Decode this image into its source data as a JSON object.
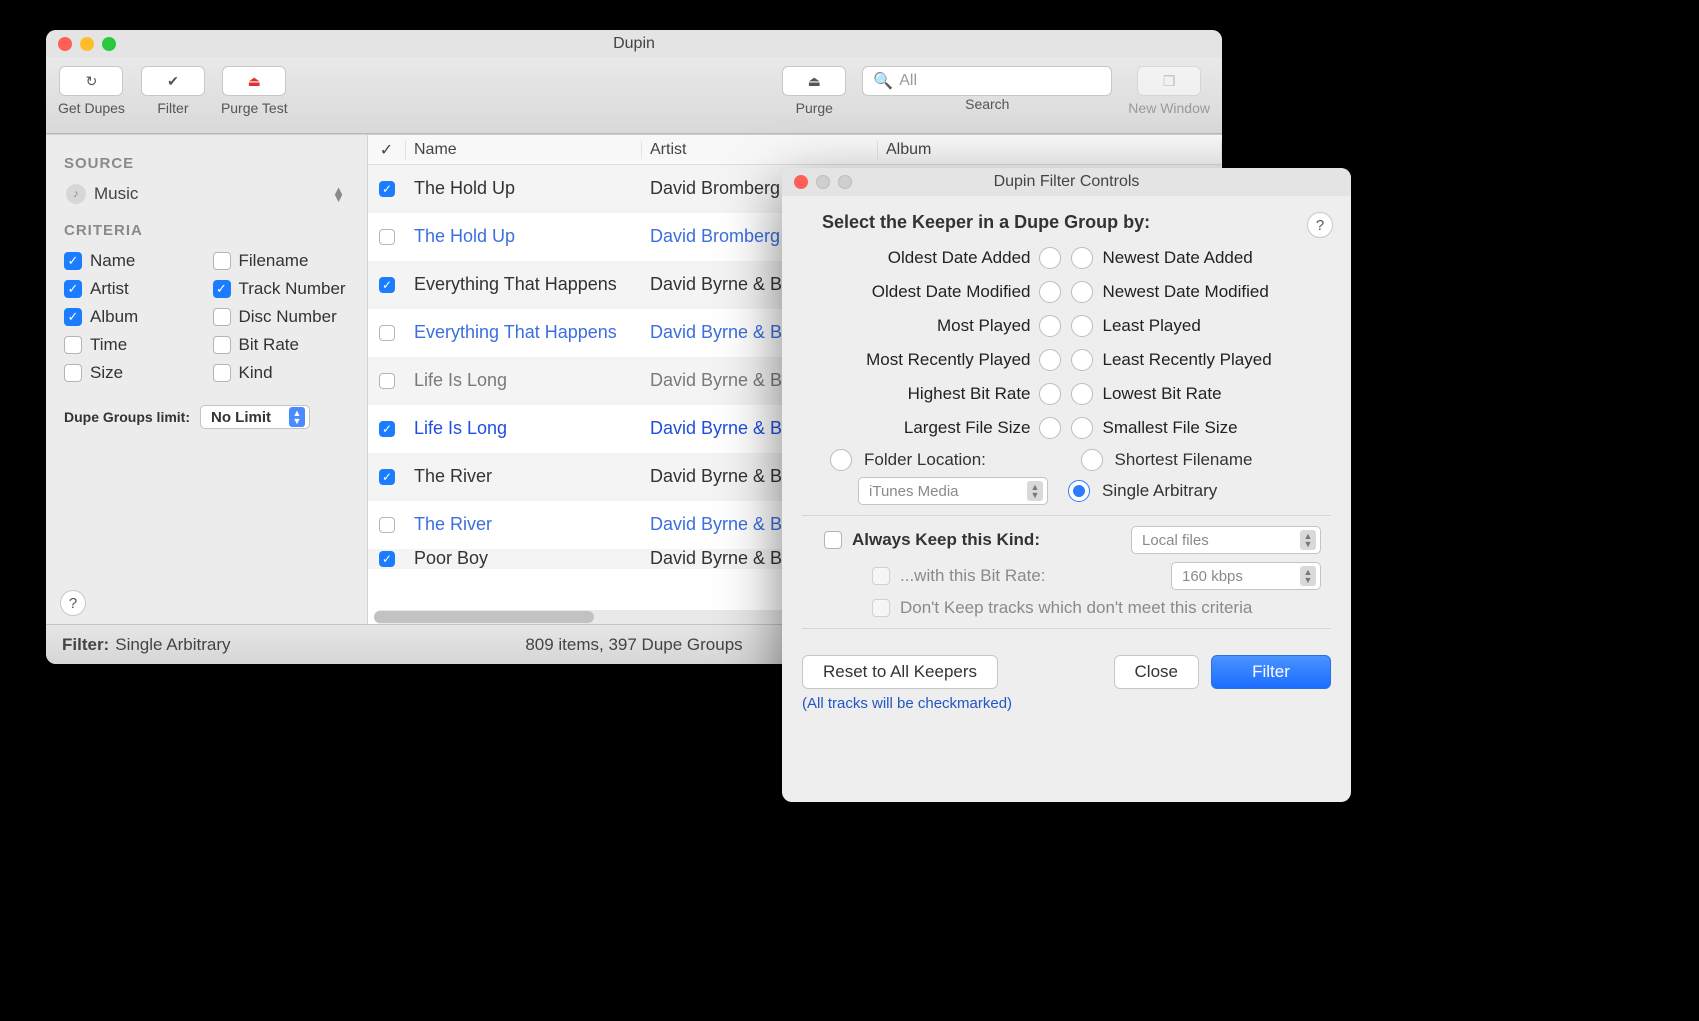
{
  "main": {
    "title": "Dupin",
    "toolbar": {
      "getDupes": "Get Dupes",
      "filter": "Filter",
      "purgeTest": "Purge Test",
      "purge": "Purge",
      "searchLabel": "Search",
      "searchPlaceholder": "All",
      "newWindow": "New Window"
    },
    "sidebar": {
      "sourceHeading": "SOURCE",
      "sourceValue": "Music",
      "criteriaHeading": "CRITERIA",
      "criteria": [
        {
          "label": "Name",
          "checked": true
        },
        {
          "label": "Filename",
          "checked": false
        },
        {
          "label": "Artist",
          "checked": true
        },
        {
          "label": "Track Number",
          "checked": true
        },
        {
          "label": "Album",
          "checked": true
        },
        {
          "label": "Disc Number",
          "checked": false
        },
        {
          "label": "Time",
          "checked": false
        },
        {
          "label": "Bit Rate",
          "checked": false
        },
        {
          "label": "Size",
          "checked": false
        },
        {
          "label": "Kind",
          "checked": false
        }
      ],
      "limitLabel": "Dupe Groups limit:",
      "limitValue": "No Limit"
    },
    "table": {
      "headers": {
        "check": "✓",
        "name": "Name",
        "artist": "Artist",
        "album": "Album"
      },
      "rows": [
        {
          "checked": true,
          "name": "The Hold Up",
          "artist": "David Bromberg",
          "style": "alt"
        },
        {
          "checked": false,
          "name": "The Hold Up",
          "artist": "David Bromberg",
          "style": "blue"
        },
        {
          "checked": true,
          "name": "Everything That Happens",
          "artist": "David Byrne & B",
          "style": "alt"
        },
        {
          "checked": false,
          "name": "Everything That Happens",
          "artist": "David Byrne & B",
          "style": "blue"
        },
        {
          "checked": false,
          "name": "Life Is Long",
          "artist": "David Byrne & B",
          "style": "gray alt"
        },
        {
          "checked": true,
          "name": "Life Is Long",
          "artist": "David Byrne & B",
          "style": "blue-strong"
        },
        {
          "checked": true,
          "name": "The River",
          "artist": "David Byrne & B",
          "style": "alt"
        },
        {
          "checked": false,
          "name": "The River",
          "artist": "David Byrne & B",
          "style": "blue"
        },
        {
          "checked": true,
          "name": "Poor Boy",
          "artist": "David Byrne & B",
          "style": "alt cut"
        }
      ]
    },
    "status": {
      "filterLabel": "Filter:",
      "filterValue": "Single Arbitrary",
      "count": "809 items, 397 Dupe Groups"
    }
  },
  "filterWin": {
    "title": "Dupin Filter Controls",
    "heading": "Select the Keeper in a Dupe Group by:",
    "pairs": [
      {
        "left": "Oldest Date Added",
        "right": "Newest Date Added"
      },
      {
        "left": "Oldest Date Modified",
        "right": "Newest Date Modified"
      },
      {
        "left": "Most Played",
        "right": "Least Played"
      },
      {
        "left": "Most Recently Played",
        "right": "Least Recently Played"
      },
      {
        "left": "Highest Bit Rate",
        "right": "Lowest Bit Rate"
      },
      {
        "left": "Largest File Size",
        "right": "Smallest File Size"
      }
    ],
    "folderLabel": "Folder Location:",
    "folderValue": "iTunes Media",
    "shortest": "Shortest Filename",
    "singleArb": "Single Arbitrary",
    "alwaysKeepLabel": "Always Keep this Kind:",
    "alwaysKeepValue": "Local files",
    "bitRateLabel": "...with this Bit Rate:",
    "bitRateValue": "160 kbps",
    "dontKeepLabel": "Don't Keep tracks which don't meet this criteria",
    "resetBtn": "Reset to All Keepers",
    "closeBtn": "Close",
    "filterBtn": "Filter",
    "note": "(All tracks will be checkmarked)"
  }
}
